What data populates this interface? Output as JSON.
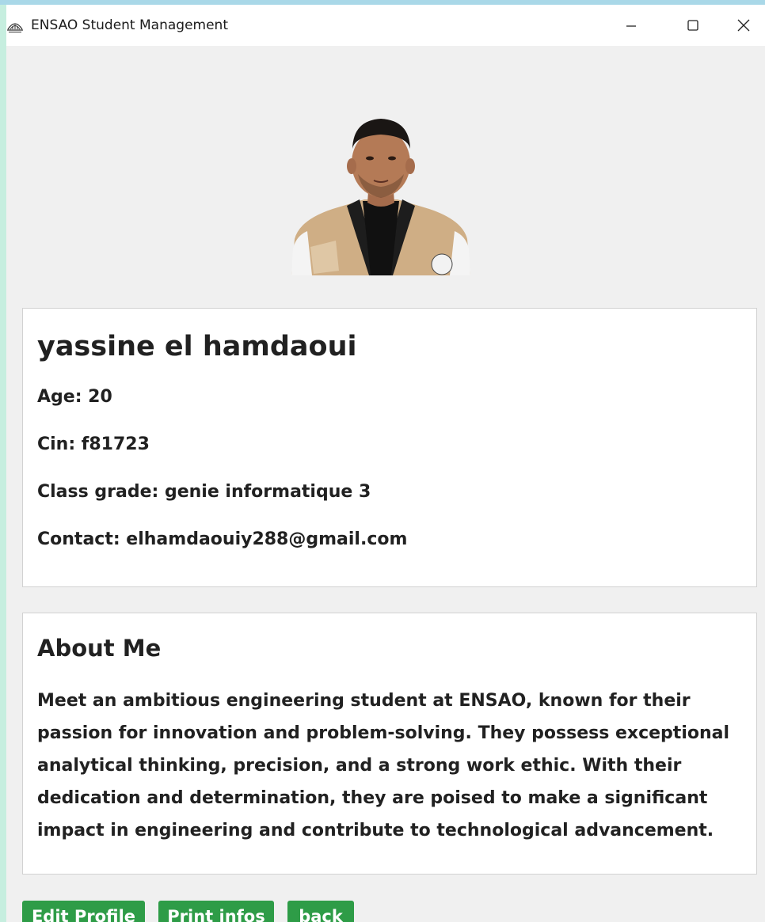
{
  "window": {
    "title": "ENSAO Student Management",
    "app_icon": "ensao-logo-icon",
    "controls": [
      "minimize-icon",
      "maximize-icon",
      "close-icon"
    ]
  },
  "profile": {
    "photo": "student-photo",
    "name": "yassine el hamdaoui",
    "age_line": "Age: 20",
    "cin_line": "Cin: f81723",
    "class_line": "Class grade: genie informatique 3",
    "contact_line": "Contact: elhamdaouiy288@gmail.com"
  },
  "about": {
    "heading": "About Me",
    "text": "Meet an ambitious engineering student at ENSAO, known for their passion for innovation and problem-solving. They possess exceptional analytical thinking, precision, and a strong work ethic. With their dedication and determination, they are poised to make a significant impact in engineering and contribute to technological advancement."
  },
  "actions": {
    "edit_label": "Edit Profile",
    "print_label": "Print infos",
    "back_label": "back"
  },
  "colors": {
    "window_background": "#f0f0f0",
    "card_background": "#ffffff",
    "button_green": "#2e9c47",
    "desktop_background": "#c6eedf"
  }
}
